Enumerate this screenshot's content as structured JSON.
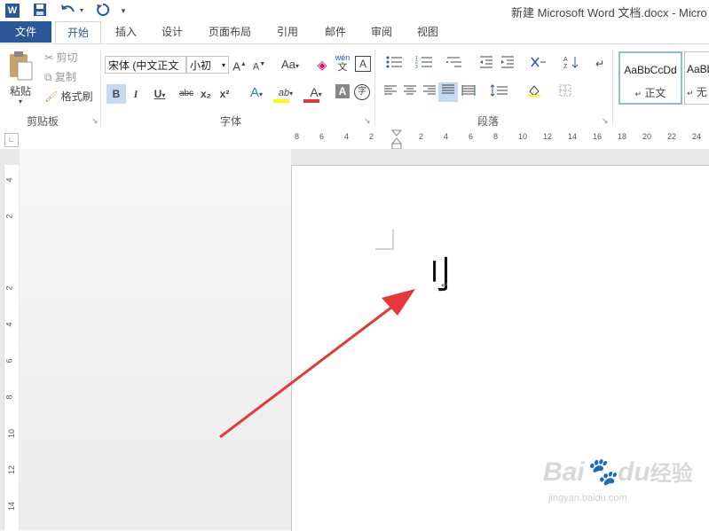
{
  "window": {
    "title": "新建 Microsoft Word 文档.docx - Micro"
  },
  "quick_access": {
    "word_icon": "W",
    "save_icon": "save-icon",
    "undo_icon": "undo-icon",
    "redo_icon": "redo-icon",
    "customize_icon": "customize-icon"
  },
  "tabs": [
    "文件",
    "开始",
    "插入",
    "设计",
    "页面布局",
    "引用",
    "邮件",
    "审阅",
    "视图"
  ],
  "clipboard": {
    "paste": "粘贴",
    "cut": "剪切",
    "copy": "复制",
    "format_painter": "格式刷",
    "group": "剪贴板"
  },
  "font": {
    "name": "宋体 (中文正文",
    "size": "小初",
    "group": "字体",
    "aa_label": "Aa",
    "bold": "B",
    "italic": "I",
    "underline": "U",
    "strike": "abc",
    "subscript": "x₂",
    "superscript": "x²",
    "pinyin_top": "wén",
    "pinyin_bottom": "文",
    "charborder": "A",
    "font_color": "A",
    "highlight": "ab",
    "text_effect": "A",
    "shade": "A",
    "enclose": "字"
  },
  "paragraph": {
    "group": "段落"
  },
  "styles": {
    "style1_sample": "AaBbCcDd",
    "style1_name": "正文",
    "style2_sample": "AaBbI",
    "style2_name": "无"
  },
  "ruler": {
    "ticks": [
      "8",
      "6",
      "4",
      "2",
      "2",
      "4",
      "6",
      "8",
      "10",
      "12",
      "14",
      "16",
      "18",
      "20",
      "22",
      "24"
    ],
    "vticks": [
      "4",
      "2",
      "2",
      "4",
      "6",
      "8",
      "10",
      "12",
      "14"
    ]
  },
  "document": {
    "text": "刂",
    "mark": "↵"
  },
  "watermark": {
    "brand": "Bai",
    "brand2": "du",
    "cn": "经验",
    "url": "jingyan.baidu.com"
  },
  "colors": {
    "accent": "#2b579a",
    "arrow": "#e8373a",
    "font_color_bar": "#e8373a",
    "highlight_bar": "#ffff00"
  }
}
